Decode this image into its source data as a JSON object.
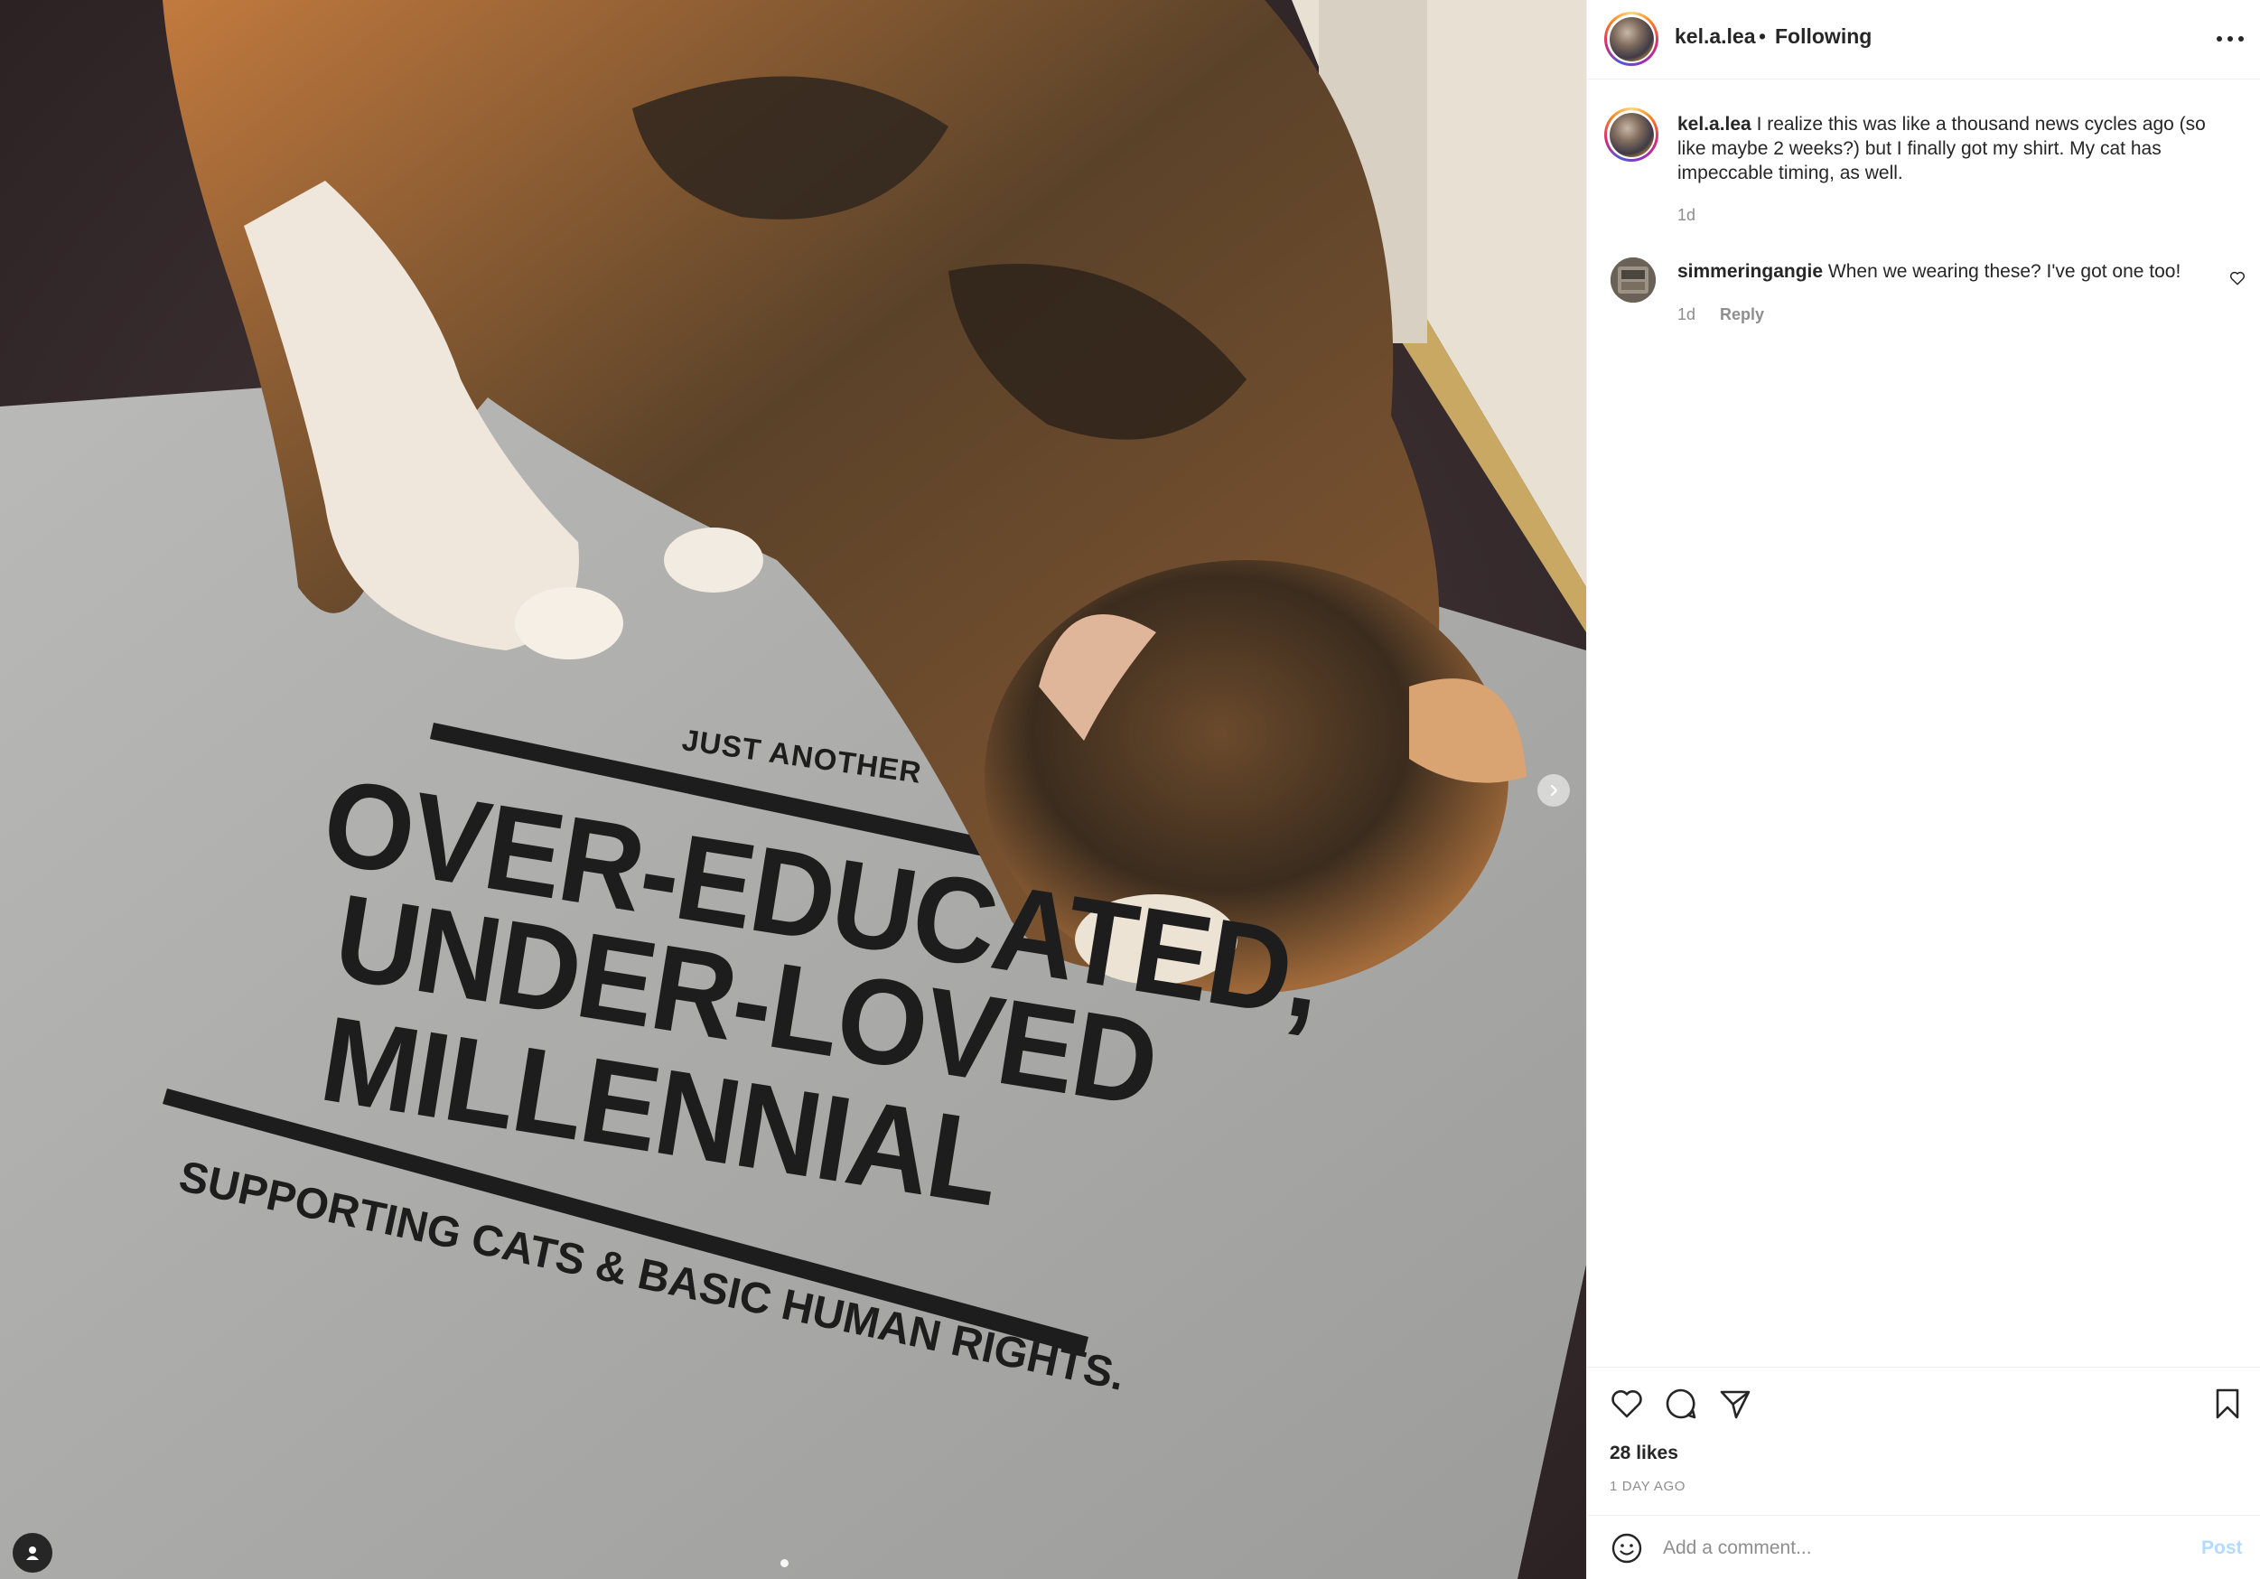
{
  "post": {
    "author": "kel.a.lea",
    "separator": "•",
    "follow_status": "Following",
    "caption": "I realize this was like a thousand news cycles ago (so like maybe 2 weeks?) but I finally got my shirt. My cat has impeccable timing, as well.",
    "caption_time": "1d",
    "likes": "28 likes",
    "date": "1 DAY AGO"
  },
  "photo": {
    "shirt_text": {
      "line1": "JUST ANOTHER",
      "line2": "OVER-EDUCATED,",
      "line3": "UNDER-LOVED",
      "line4": "MILLENNIAL",
      "line5": "SUPPORTING CATS & BASIC HUMAN RIGHTS."
    },
    "carousel_index": 1,
    "carousel_count": 1
  },
  "comments": [
    {
      "user": "simmeringangie",
      "text": "When we wearing these? I've got one too!",
      "time": "1d",
      "reply_label": "Reply"
    }
  ],
  "composer": {
    "placeholder": "Add a comment...",
    "post_label": "Post"
  },
  "colors": {
    "accent_disabled": "#b3dbff",
    "text_primary": "#262626",
    "text_secondary": "#8e8e8e",
    "divider": "#efefef"
  },
  "icons": {
    "header_menu": "more-horizontal-icon",
    "like": "heart-icon",
    "comment": "speech-bubble-icon",
    "share": "paper-plane-icon",
    "save": "bookmark-icon",
    "emoji": "smiley-icon",
    "carousel_next": "chevron-right-icon",
    "user_tag": "person-icon"
  }
}
